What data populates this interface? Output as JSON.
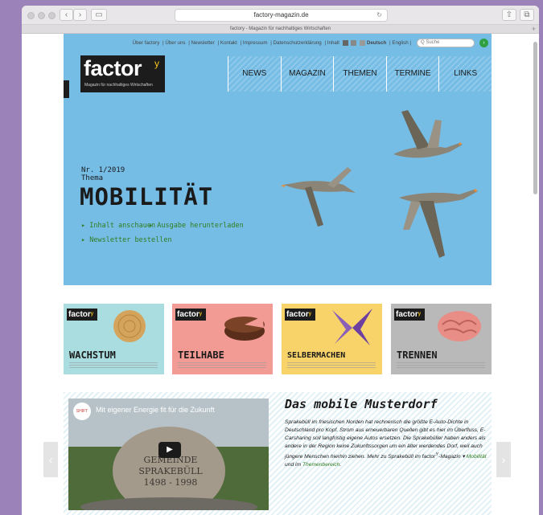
{
  "browser": {
    "url": "factory-magazin.de",
    "tab_title": "factory - Magazin für nachhaltiges Wirtschaften",
    "back_glyph": "‹",
    "forward_glyph": "›",
    "sidebar_glyph": "▭",
    "reload_glyph": "↻",
    "share_glyph": "⇧",
    "tabs_glyph": "⧉",
    "newtab_glyph": "+"
  },
  "topnav": {
    "items": [
      "Über factory",
      "| Über uns",
      "| Newsletter",
      "| Kontakt",
      "| Impressum",
      "| Datenschutzerklärung",
      "| Inhalt"
    ],
    "lang_de": "Deutsch",
    "lang_sep": "| English |",
    "search_placeholder": "Q Suche",
    "go_glyph": "›"
  },
  "logo": {
    "word": "factor",
    "sup": "y",
    "tagline": "Magazin für nachhaltiges Wirtschaften",
    "side": "tagged"
  },
  "mainnav": [
    "NEWS",
    "MAGAZIN",
    "THEMEN",
    "TERMINE",
    "LINKS"
  ],
  "hero": {
    "issue": "Nr. 1/2019",
    "thema": "Thema",
    "title": "MOBILITÄT",
    "links": [
      "▸ Inhalt anschauen",
      "▸ Ausgabe herunterladen",
      "▸ Newsletter bestellen"
    ]
  },
  "cards": [
    {
      "title": "WACHSTUM",
      "bg": "#a9dde0"
    },
    {
      "title": "TEILHABE",
      "bg": "#f29a94"
    },
    {
      "title": "SELBERMACHEN",
      "bg": "#f7d36a"
    },
    {
      "title": "TRENNEN",
      "bg": "#b9b9b9"
    }
  ],
  "card_mini": {
    "word": "factor",
    "sup": "y"
  },
  "feature": {
    "video_title": "Mit eigener Energie fit für die Zukunft",
    "channel": "SHIFT",
    "play_glyph": "▶",
    "stone_text": "GEMEINDE SPRAKEBÜLL 1498 - 1998",
    "title": "Das mobile Musterdorf",
    "text": "Sprakebüll im friesischen Norden hat rechnerisch die größte E-Auto-Dichte in Deutschland pro Kopf. Strom aus erneuerbaren Quellen gibt es hier im Überfluss, E-Carsharing soll langfristig eigene Autos ersetzen. Die Sprakebüller haben anders als andere in der Region keine Zukunftssorgen um ein älter werdendes Dorf, weil auch jüngere Menschen hierhin ziehen. Mehr zu Sprakebüll im factor",
    "text_sup": "Y",
    "text_mid": "-Magazin ▾",
    "link1": "Mobilität",
    "text_and": "und im",
    "link2": "Themenbereich",
    "text_end": "."
  },
  "arrows": {
    "left": "‹",
    "right": "›"
  }
}
